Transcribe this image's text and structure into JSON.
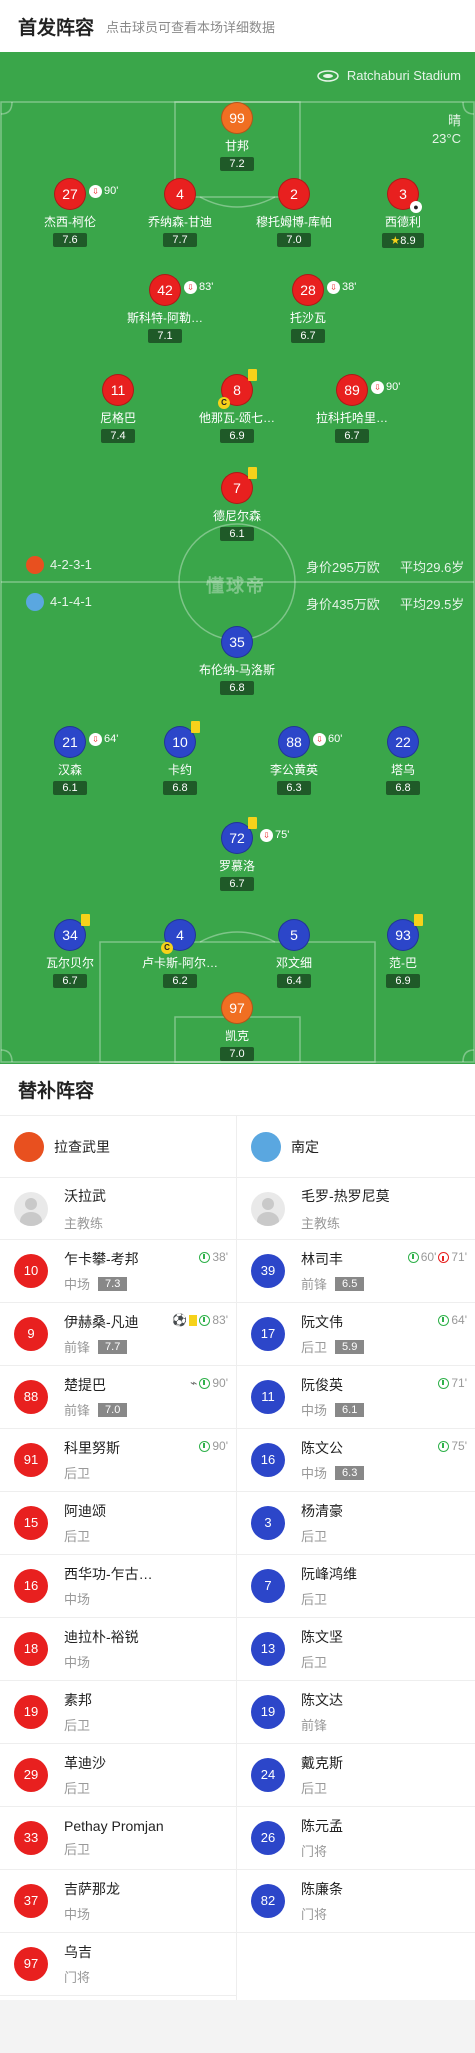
{
  "header": {
    "title": "首发阵容",
    "subtitle": "点击球员可查看本场详细数据"
  },
  "pitch": {
    "stadium": "Ratchaburi Stadium",
    "weather": "晴",
    "temperature": "23°C",
    "watermark": "懂球帝"
  },
  "home_team": {
    "formation": "4-2-3-1",
    "value": "身价295万欧",
    "avg_age": "平均29.6岁"
  },
  "away_team": {
    "formation": "4-1-4-1",
    "value": "身价435万欧",
    "avg_age": "平均29.5岁"
  },
  "home_lineup": [
    {
      "num": "99",
      "name": "甘邦",
      "rating": "7.2"
    },
    {
      "num": "27",
      "name": "杰西-柯伦",
      "rating": "7.6",
      "sub": "90'"
    },
    {
      "num": "4",
      "name": "乔纳森-甘迪",
      "rating": "7.7"
    },
    {
      "num": "2",
      "name": "穆托姆博-库帕",
      "rating": "7.0"
    },
    {
      "num": "3",
      "name": "西德利",
      "rating": "8.9"
    },
    {
      "num": "42",
      "name": "斯科特-阿勒…",
      "rating": "7.1",
      "sub": "83'"
    },
    {
      "num": "28",
      "name": "托沙瓦",
      "rating": "6.7",
      "sub": "38'"
    },
    {
      "num": "11",
      "name": "尼格巴",
      "rating": "7.4"
    },
    {
      "num": "8",
      "name": "他那瓦-颂七…",
      "rating": "6.9"
    },
    {
      "num": "89",
      "name": "拉科托哈里…",
      "rating": "6.7",
      "sub": "90'"
    },
    {
      "num": "7",
      "name": "德尼尔森",
      "rating": "6.1"
    }
  ],
  "away_lineup": [
    {
      "num": "35",
      "name": "布伦纳-马洛斯",
      "rating": "6.8"
    },
    {
      "num": "21",
      "name": "汉森",
      "rating": "6.1",
      "sub": "64'"
    },
    {
      "num": "10",
      "name": "卡约",
      "rating": "6.8"
    },
    {
      "num": "88",
      "name": "李公黄英",
      "rating": "6.3",
      "sub": "60'"
    },
    {
      "num": "22",
      "name": "塔乌",
      "rating": "6.8"
    },
    {
      "num": "72",
      "name": "罗慕洛",
      "rating": "6.7",
      "sub": "75'"
    },
    {
      "num": "34",
      "name": "瓦尔贝尔",
      "rating": "6.7"
    },
    {
      "num": "4",
      "name": "卢卡斯-阿尔…",
      "rating": "6.2"
    },
    {
      "num": "5",
      "name": "邓文细",
      "rating": "6.4"
    },
    {
      "num": "93",
      "name": "范-巴",
      "rating": "6.9"
    },
    {
      "num": "97",
      "name": "凯克",
      "rating": "7.0"
    }
  ],
  "subs_title": "替补阵容",
  "home_subs": {
    "team": "拉查武里",
    "coach": {
      "name": "沃拉武",
      "role": "主教练"
    },
    "players": [
      {
        "num": "10",
        "name": "乍卡攀-考邦",
        "pos": "中场",
        "rating": "7.3",
        "ev": "38'"
      },
      {
        "num": "9",
        "name": "伊赫桑-凡迪",
        "pos": "前锋",
        "rating": "7.7",
        "ev": "83'"
      },
      {
        "num": "88",
        "name": "楚提巴",
        "pos": "前锋",
        "rating": "7.0",
        "ev": "90'"
      },
      {
        "num": "91",
        "name": "科里努斯",
        "pos": "后卫",
        "ev": "90'"
      },
      {
        "num": "15",
        "name": "阿迪颂",
        "pos": "后卫"
      },
      {
        "num": "16",
        "name": "西华功-乍古…",
        "pos": "中场"
      },
      {
        "num": "18",
        "name": "迪拉朴-裕锐",
        "pos": "中场"
      },
      {
        "num": "19",
        "name": "素邦",
        "pos": "后卫"
      },
      {
        "num": "29",
        "name": "革迪沙",
        "pos": "后卫"
      },
      {
        "num": "33",
        "name": "Pethay Promjan",
        "pos": "后卫"
      },
      {
        "num": "37",
        "name": "吉萨那龙",
        "pos": "中场"
      },
      {
        "num": "97",
        "name": "乌吉",
        "pos": "门将"
      }
    ]
  },
  "away_subs": {
    "team": "南定",
    "coach": {
      "name": "毛罗-热罗尼莫",
      "role": "主教练"
    },
    "players": [
      {
        "num": "39",
        "name": "林司丰",
        "pos": "前锋",
        "rating": "6.5",
        "ev": "60'",
        "ev2": "71'"
      },
      {
        "num": "17",
        "name": "阮文伟",
        "pos": "后卫",
        "rating": "5.9",
        "ev": "64'"
      },
      {
        "num": "11",
        "name": "阮俊英",
        "pos": "中场",
        "rating": "6.1",
        "ev": "71'"
      },
      {
        "num": "16",
        "name": "陈文公",
        "pos": "中场",
        "rating": "6.3",
        "ev": "75'"
      },
      {
        "num": "3",
        "name": "杨清豪",
        "pos": "后卫"
      },
      {
        "num": "7",
        "name": "阮峰鸿维",
        "pos": "后卫"
      },
      {
        "num": "13",
        "name": "陈文坚",
        "pos": "后卫"
      },
      {
        "num": "19",
        "name": "陈文达",
        "pos": "前锋"
      },
      {
        "num": "24",
        "name": "戴克斯",
        "pos": "后卫"
      },
      {
        "num": "26",
        "name": "陈元孟",
        "pos": "门将"
      },
      {
        "num": "82",
        "name": "陈廉条",
        "pos": "门将"
      }
    ]
  },
  "colors": {
    "pitch": "#3aa64a",
    "home": "#e8201f",
    "away": "#2c46c9",
    "keeper": "#f06f22"
  }
}
